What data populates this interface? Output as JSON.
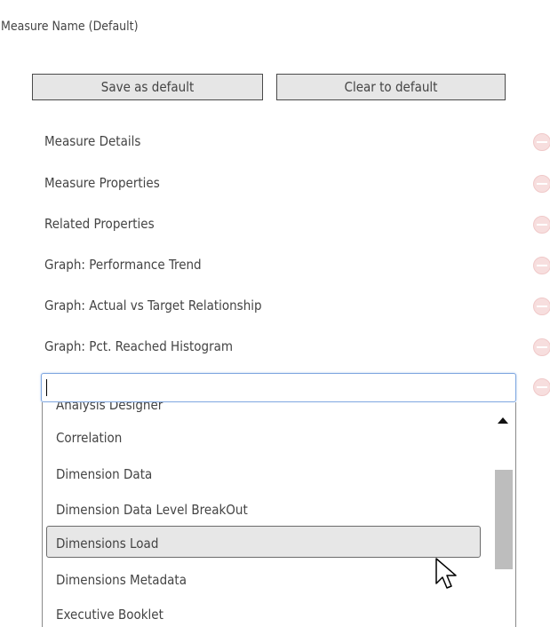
{
  "header": {
    "title": "Measure Name (Default)"
  },
  "buttons": {
    "save_label": "Save as default",
    "clear_label": "Clear to default"
  },
  "sections": [
    {
      "label": "Measure Details",
      "remove_icon": "remove-circle-icon"
    },
    {
      "label": "Measure Properties",
      "remove_icon": "remove-circle-icon"
    },
    {
      "label": "Related Properties",
      "remove_icon": "remove-circle-icon"
    },
    {
      "label": "Graph: Performance Trend",
      "remove_icon": "remove-circle-icon"
    },
    {
      "label": "Graph: Actual vs Target Relationship",
      "remove_icon": "remove-circle-icon"
    },
    {
      "label": "Graph: Pct. Reached Histogram",
      "remove_icon": "remove-circle-icon"
    }
  ],
  "combo": {
    "value": "",
    "placeholder": "",
    "remove_icon": "remove-circle-icon"
  },
  "dropdown": {
    "partially_visible_item": "Analysis Designer",
    "items": [
      "Correlation",
      "Dimension Data",
      "Dimension Data Level BreakOut",
      "Dimensions Load",
      "Dimensions Metadata",
      "Executive Booklet"
    ],
    "highlighted": "Dimensions Load"
  },
  "colors": {
    "text": "#444444",
    "button_bg": "#e6e6e6",
    "focus_border": "#7fa7e0",
    "remove_icon": "#f7dede",
    "highlight_bg": "#e7e7e7",
    "scroll_thumb": "#bdbdbd"
  }
}
